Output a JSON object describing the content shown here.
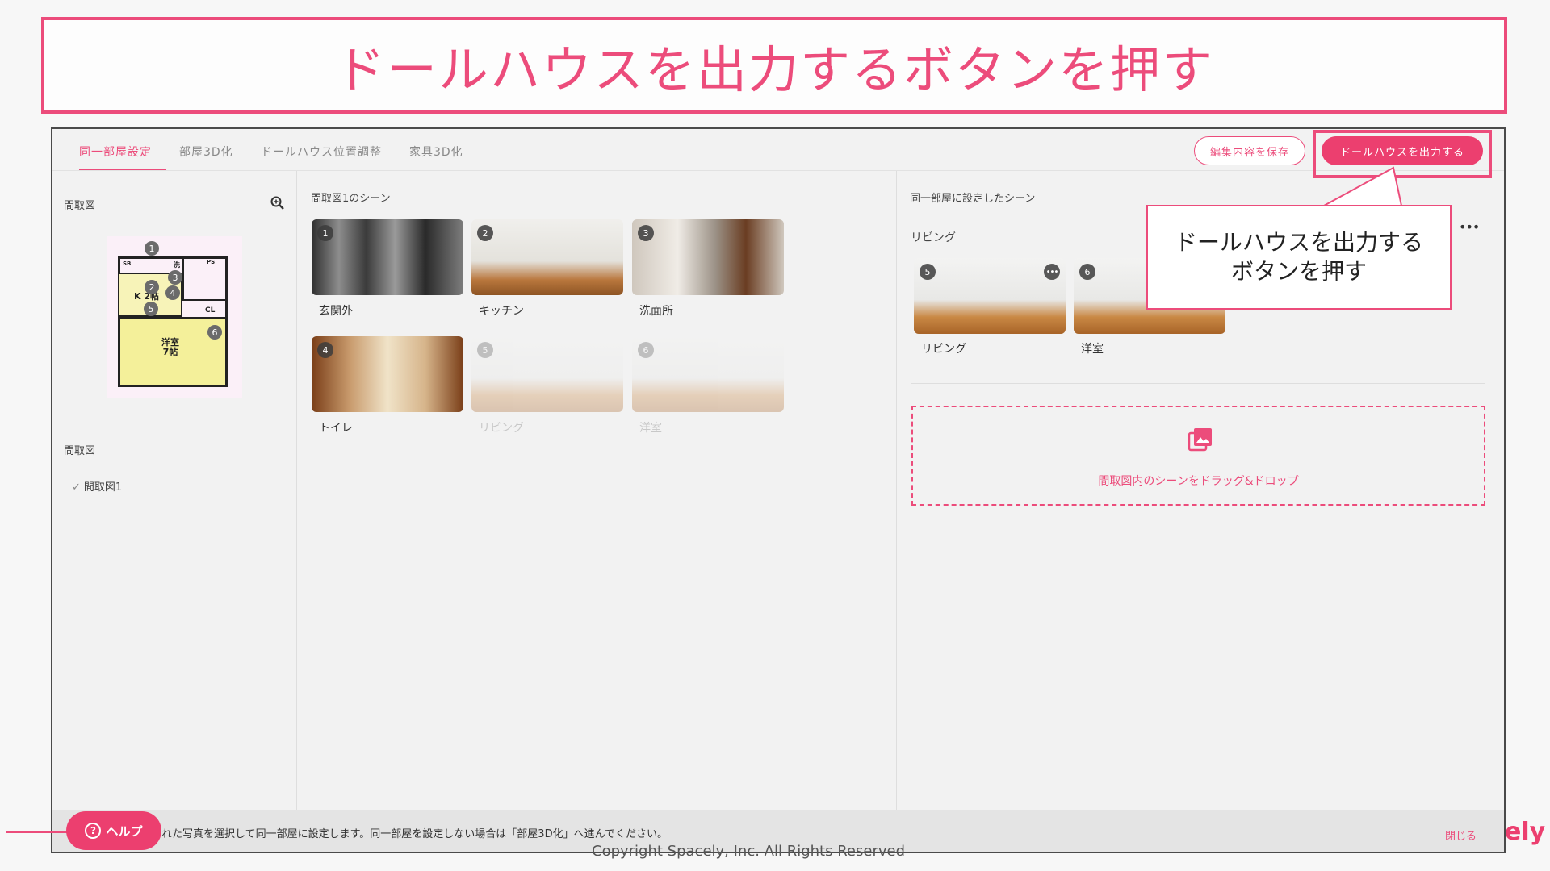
{
  "banner": {
    "title": "ドールハウスを出力するボタンを押す"
  },
  "tabs": [
    {
      "label": "同一部屋設定",
      "active": true
    },
    {
      "label": "部屋3D化",
      "active": false
    },
    {
      "label": "ドールハウス位置調整",
      "active": false
    },
    {
      "label": "家具3D化",
      "active": false
    }
  ],
  "toolbar": {
    "save_label": "編集内容を保存",
    "export_label": "ドールハウスを出力する"
  },
  "left_panel": {
    "floorplan_title": "間取図",
    "floorplan_list_title": "間取図",
    "floorplan_items": [
      {
        "label": "間取図1",
        "checked": true
      }
    ],
    "floorplan_markers": [
      "1",
      "2",
      "3",
      "4",
      "5",
      "6"
    ],
    "floorplan_texts": {
      "kitchen": "K 2帖",
      "western_room": "洋室\n7帖",
      "closet": "CL",
      "sb": "SB",
      "wash": "洗",
      "ps": "PS"
    }
  },
  "middle_panel": {
    "title": "間取図1のシーン",
    "scenes": [
      {
        "number": "1",
        "label": "玄関外",
        "dimmed": false
      },
      {
        "number": "2",
        "label": "キッチン",
        "dimmed": false
      },
      {
        "number": "3",
        "label": "洗面所",
        "dimmed": false
      },
      {
        "number": "4",
        "label": "トイレ",
        "dimmed": false
      },
      {
        "number": "5",
        "label": "リビング",
        "dimmed": true
      },
      {
        "number": "6",
        "label": "洋室",
        "dimmed": true
      }
    ]
  },
  "right_panel": {
    "title": "同一部屋に設定したシーン",
    "group_name": "リビング",
    "group_scenes": [
      {
        "number": "5",
        "label": "リビング"
      },
      {
        "number": "6",
        "label": "洋室"
      }
    ],
    "dropzone_label": "間取図内のシーンをドラッグ&ドロップ"
  },
  "callout": {
    "text": "ドールハウスを出力する\nボタンを押す"
  },
  "bottom_bar": {
    "message": "れた写真を選択して同一部屋に設定します。同一部屋を設定しない場合は「部屋3D化」へ進んでください。",
    "close_label": "閉じる"
  },
  "help": {
    "label": "ヘルプ"
  },
  "brand_fragment": "ely",
  "copyright": "Copyright Spacely, Inc. All Rights Reserved",
  "colors": {
    "accent": "#ec4c7b",
    "accent_button": "#ec3f6f",
    "panel_bg": "#f2f2f2"
  },
  "icons": [
    "zoom-in-icon",
    "check-icon",
    "image-icon",
    "more-icon",
    "help-icon"
  ]
}
